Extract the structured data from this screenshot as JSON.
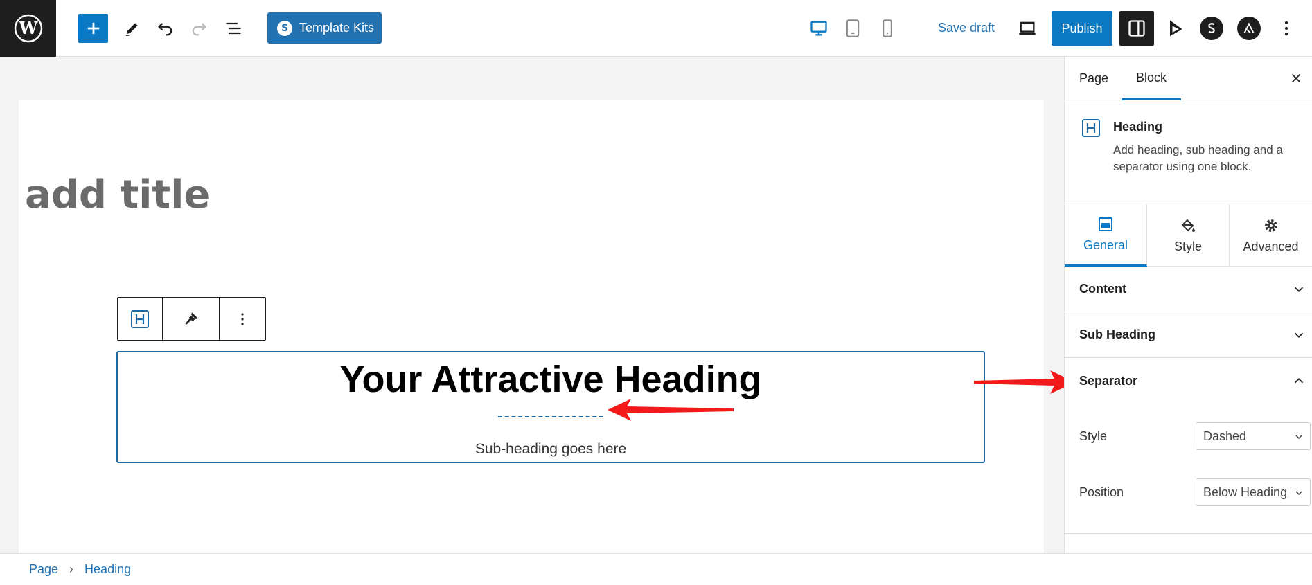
{
  "toolbar": {
    "template_kits_label": "Template Kits",
    "save_draft_label": "Save draft",
    "publish_label": "Publish"
  },
  "canvas": {
    "title_placeholder": "add title",
    "heading": "Your Attractive Heading",
    "subheading": "Sub-heading goes here"
  },
  "sidebar": {
    "tabs": [
      {
        "label": "Page"
      },
      {
        "label": "Block"
      }
    ],
    "block": {
      "title": "Heading",
      "description": "Add heading, sub heading and a separator using one block."
    },
    "panel_tabs": [
      {
        "label": "General"
      },
      {
        "label": "Style"
      },
      {
        "label": "Advanced"
      }
    ],
    "sections": [
      {
        "label": "Content"
      },
      {
        "label": "Sub Heading"
      },
      {
        "label": "Separator"
      }
    ],
    "separator_fields": [
      {
        "label": "Style",
        "value": "Dashed"
      },
      {
        "label": "Position",
        "value": "Below Heading"
      }
    ]
  },
  "breadcrumb": [
    {
      "label": "Page"
    },
    {
      "label": "Heading"
    }
  ],
  "colors": {
    "accent": "#0a78c2",
    "dark": "#1e1e1e",
    "arrow": "#f21a1a",
    "separator": "#1b6aa5"
  }
}
